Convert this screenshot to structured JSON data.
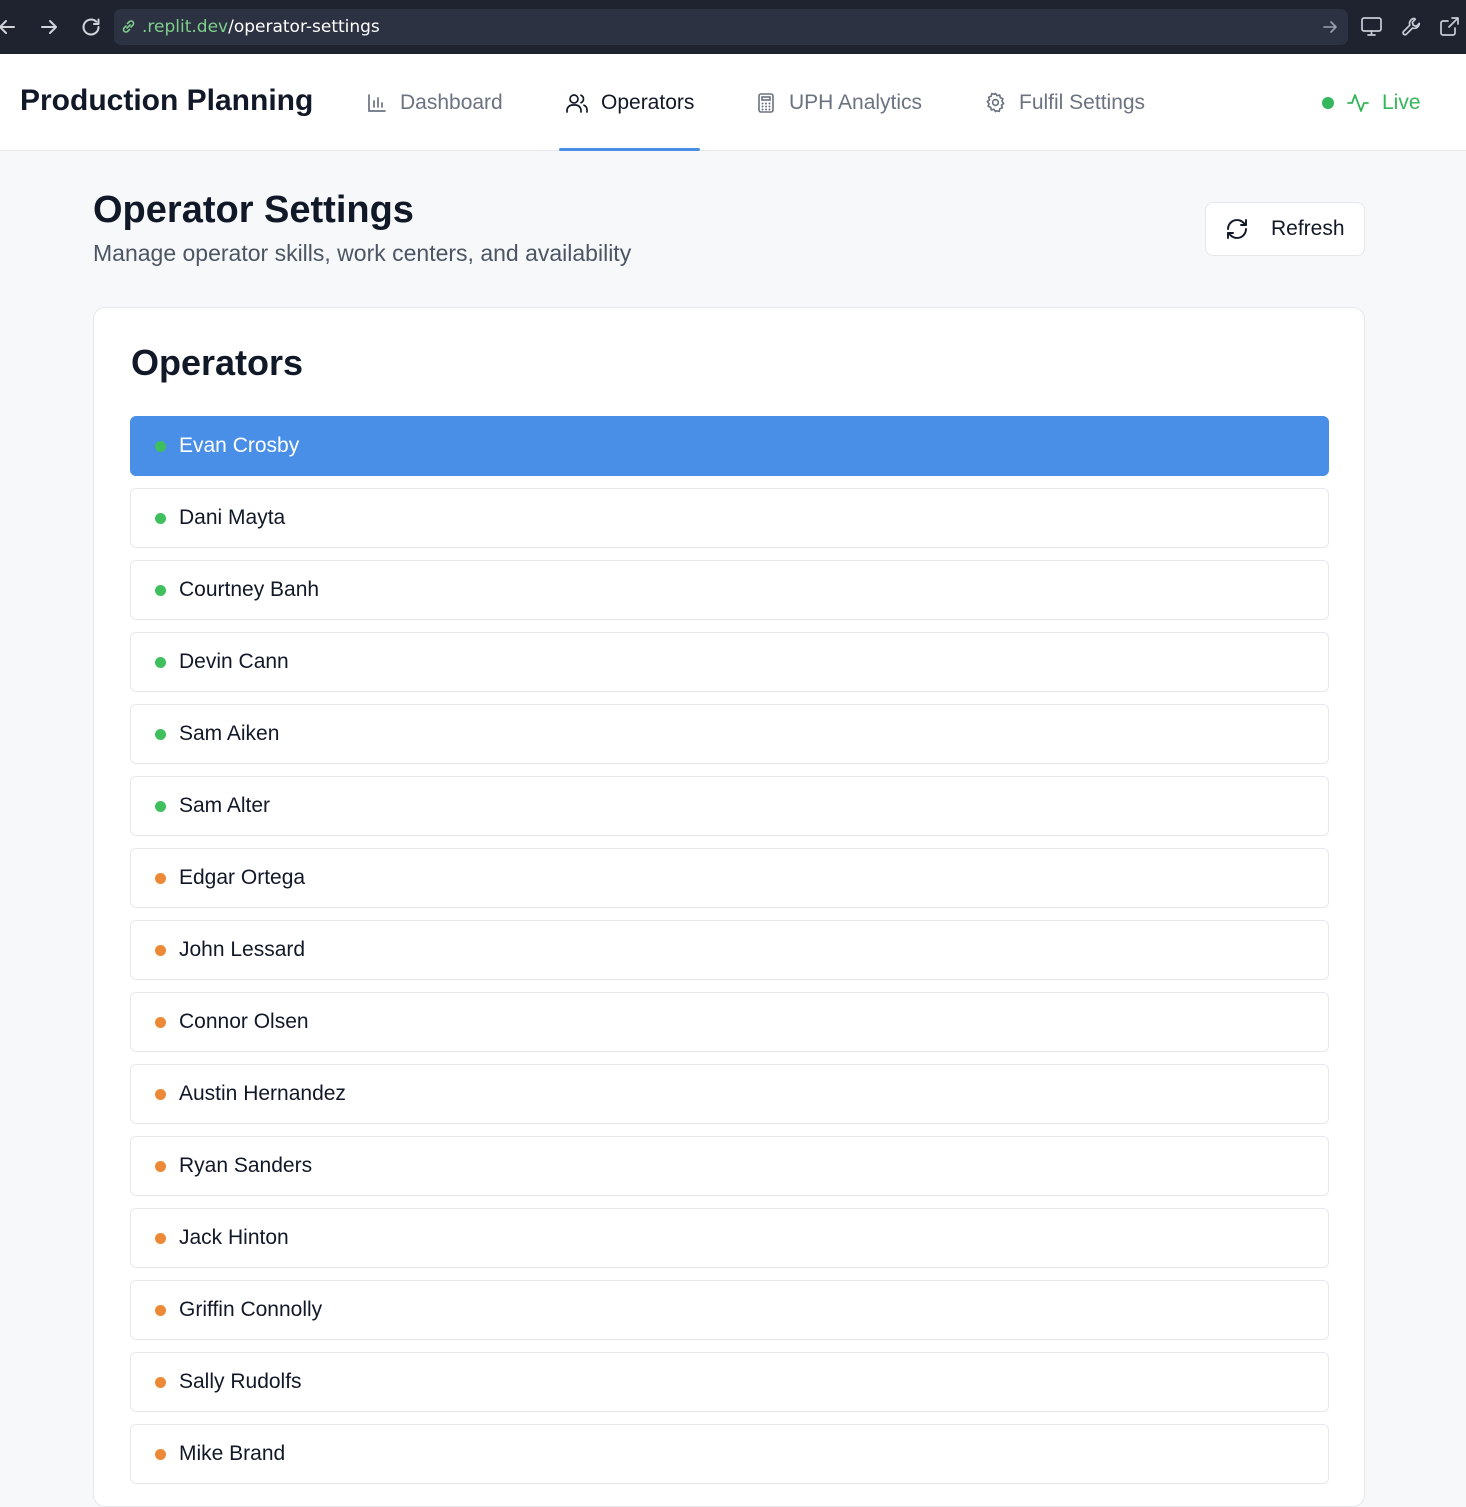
{
  "browser": {
    "url_host": ".replit.dev",
    "url_path": "/operator-settings"
  },
  "app": {
    "title": "Production Planning"
  },
  "nav": {
    "tabs": [
      {
        "label": "Dashboard",
        "icon": "bar-chart-icon",
        "active": false
      },
      {
        "label": "Operators",
        "icon": "users-icon",
        "active": true
      },
      {
        "label": "UPH Analytics",
        "icon": "calculator-icon",
        "active": false
      },
      {
        "label": "Fulfil Settings",
        "icon": "gear-icon",
        "active": false
      }
    ],
    "live_label": "Live"
  },
  "page": {
    "title": "Operator Settings",
    "subtitle": "Manage operator skills, work centers, and availability",
    "refresh_label": "Refresh"
  },
  "operators_card": {
    "title": "Operators",
    "items": [
      {
        "name": "Evan Crosby",
        "status": "available",
        "selected": true
      },
      {
        "name": "Dani Mayta",
        "status": "available",
        "selected": false
      },
      {
        "name": "Courtney Banh",
        "status": "available",
        "selected": false
      },
      {
        "name": "Devin Cann",
        "status": "available",
        "selected": false
      },
      {
        "name": "Sam Aiken",
        "status": "available",
        "selected": false
      },
      {
        "name": "Sam Alter",
        "status": "available",
        "selected": false
      },
      {
        "name": "Edgar Ortega",
        "status": "unavailable",
        "selected": false
      },
      {
        "name": "John Lessard",
        "status": "unavailable",
        "selected": false
      },
      {
        "name": "Connor Olsen",
        "status": "unavailable",
        "selected": false
      },
      {
        "name": "Austin Hernandez",
        "status": "unavailable",
        "selected": false
      },
      {
        "name": "Ryan Sanders",
        "status": "unavailable",
        "selected": false
      },
      {
        "name": "Jack Hinton",
        "status": "unavailable",
        "selected": false
      },
      {
        "name": "Griffin Connolly",
        "status": "unavailable",
        "selected": false
      },
      {
        "name": "Sally Rudolfs",
        "status": "unavailable",
        "selected": false
      },
      {
        "name": "Mike Brand",
        "status": "unavailable",
        "selected": false
      }
    ]
  },
  "colors": {
    "accent": "#4a8fe7",
    "available": "#3fbf5e",
    "unavailable": "#ed8936",
    "live": "#34b65a"
  }
}
